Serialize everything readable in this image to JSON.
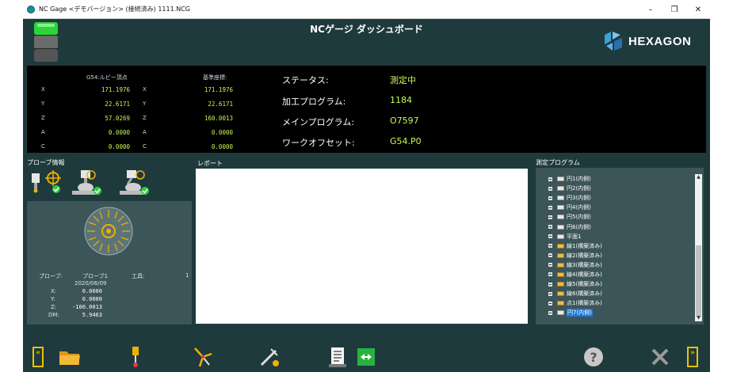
{
  "window": {
    "title": "NC Gage <デモバージョン> (接続済み)  1111.NCG",
    "controls": {
      "minimize": "–",
      "maximize": "❐",
      "close": "✕"
    }
  },
  "header": {
    "title": "NCゲージ ダッシュボード",
    "logo": "HEXAGON"
  },
  "coords": {
    "col1_header": "G54:ルビー頂点",
    "col2_header": "基準座標:",
    "rows": [
      {
        "axis": "X",
        "v1": "171.1976",
        "axis2": "X",
        "v2": "171.1976"
      },
      {
        "axis": "Y",
        "v1": "22.6171",
        "axis2": "Y",
        "v2": "22.6171"
      },
      {
        "axis": "Z",
        "v1": "57.0269",
        "axis2": "Z",
        "v2": "160.0013"
      },
      {
        "axis": "A",
        "v1": "0.0000",
        "axis2": "A",
        "v2": "0.0000"
      },
      {
        "axis": "C",
        "v1": "0.0000",
        "axis2": "C",
        "v2": "0.0000"
      }
    ]
  },
  "status": [
    {
      "label": "ステータス:",
      "value": "測定中"
    },
    {
      "label": "加工プログラム:",
      "value": "1184"
    },
    {
      "label": "メインプログラム:",
      "value": "O7597"
    },
    {
      "label": "ワークオフセット:",
      "value": "G54.P0"
    }
  ],
  "probe_info": {
    "label": "プローブ情報",
    "probe_label": "プローブ:",
    "probe_value": "プローブ1",
    "date": "2020/06/09",
    "tool_label": "工具:",
    "tool_value": "1",
    "rows": [
      {
        "label": "X:",
        "value": "0.0000"
      },
      {
        "label": "Y:",
        "value": "0.0000"
      },
      {
        "label": "Z:",
        "value": "-100.0013"
      },
      {
        "label": "DM:",
        "value": "5.9463"
      }
    ]
  },
  "report": {
    "label": "レポート"
  },
  "programs": {
    "label": "測定プログラム",
    "items": [
      {
        "name": "円1(内側)",
        "icon": "closed"
      },
      {
        "name": "円2(内側)",
        "icon": "closed"
      },
      {
        "name": "円3(内側)",
        "icon": "closed"
      },
      {
        "name": "円4(内側)",
        "icon": "closed"
      },
      {
        "name": "円5(内側)",
        "icon": "closed"
      },
      {
        "name": "円6(内側)",
        "icon": "closed"
      },
      {
        "name": "平面1",
        "icon": "closed"
      },
      {
        "name": "線1(構築済み)",
        "icon": "open"
      },
      {
        "name": "線2(構築済み)",
        "icon": "open"
      },
      {
        "name": "線3(構築済み)",
        "icon": "open"
      },
      {
        "name": "線4(構築済み)",
        "icon": "open"
      },
      {
        "name": "線5(構築済み)",
        "icon": "open"
      },
      {
        "name": "線6(構築済み)",
        "icon": "open"
      },
      {
        "name": "点1(構築済み)",
        "icon": "open"
      },
      {
        "name": "円7(内側)",
        "icon": "closed",
        "selected": true
      }
    ]
  },
  "toolbar": {
    "prev": "«",
    "next": "»"
  },
  "colors": {
    "background": "#1f3a3c",
    "accent": "#c6f94f",
    "panel": "#3c5558",
    "yellow": "#f0c000"
  }
}
